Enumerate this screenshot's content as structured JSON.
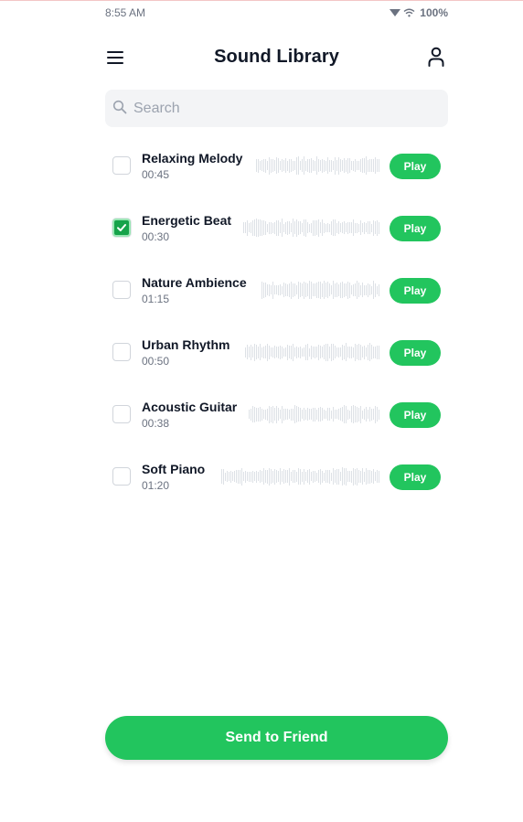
{
  "status_bar": {
    "time": "8:55 AM",
    "battery": "100%",
    "icons": [
      "signal-icon",
      "wifi-icon"
    ]
  },
  "header": {
    "title": "Sound Library",
    "menu_icon": "hamburger-menu-icon",
    "profile_icon": "user-profile-icon"
  },
  "search": {
    "placeholder": "Search",
    "value": "",
    "icon": "search-icon"
  },
  "sounds": [
    {
      "name": "Relaxing Melody",
      "duration": "00:45",
      "checked": false,
      "play_label": "Play"
    },
    {
      "name": "Energetic Beat",
      "duration": "00:30",
      "checked": true,
      "play_label": "Play"
    },
    {
      "name": "Nature Ambience",
      "duration": "01:15",
      "checked": false,
      "play_label": "Play"
    },
    {
      "name": "Urban Rhythm",
      "duration": "00:50",
      "checked": false,
      "play_label": "Play"
    },
    {
      "name": "Acoustic Guitar",
      "duration": "00:38",
      "checked": false,
      "play_label": "Play"
    },
    {
      "name": "Soft Piano",
      "duration": "01:20",
      "checked": false,
      "play_label": "Play"
    }
  ],
  "footer": {
    "send_label": "Send to Friend"
  },
  "colors": {
    "accent": "#22c55e",
    "checked": "#16a34a",
    "search_bg": "#f3f4f6",
    "waveform": "#dde1e6"
  }
}
